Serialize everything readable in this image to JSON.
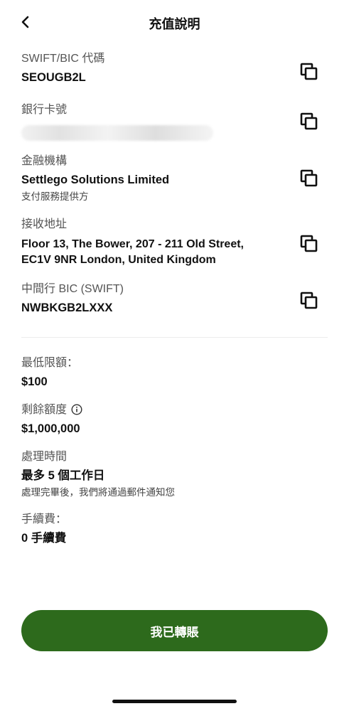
{
  "header": {
    "title": "充值說明",
    "back_icon": "chevron-left-icon"
  },
  "bank_details": [
    {
      "label": "SWIFT/BIC 代碼",
      "value": "SEOUGB2L"
    },
    {
      "label": "銀行卡號",
      "value": ""
    },
    {
      "label": "金融機構",
      "value": "Settlego Solutions Limited",
      "sub": "支付服務提供方"
    },
    {
      "label": "接收地址",
      "value_line1": "Floor 13, The Bower, 207 - 211 Old Street,",
      "value_line2": "EC1V 9NR London, United Kingdom"
    },
    {
      "label": "中間行 BIC (SWIFT)",
      "value": "NWBKGB2LXXX"
    }
  ],
  "limits": {
    "min_label": "最低限額：",
    "min_value": "$100",
    "remaining_label": "剩餘額度",
    "remaining_value": "$1,000,000",
    "processing_label": "處理時間",
    "processing_value": "最多 5 個工作日",
    "processing_note": "處理完畢後，我們將通過郵件通知您",
    "fee_label": "手續費：",
    "fee_value": "0 手續費"
  },
  "cta": {
    "label": "我已轉賬"
  },
  "colors": {
    "accent": "#2d6a1c",
    "text": "#111111",
    "muted": "#555555"
  },
  "icons": {
    "copy": "copy-icon",
    "info": "info-icon"
  }
}
